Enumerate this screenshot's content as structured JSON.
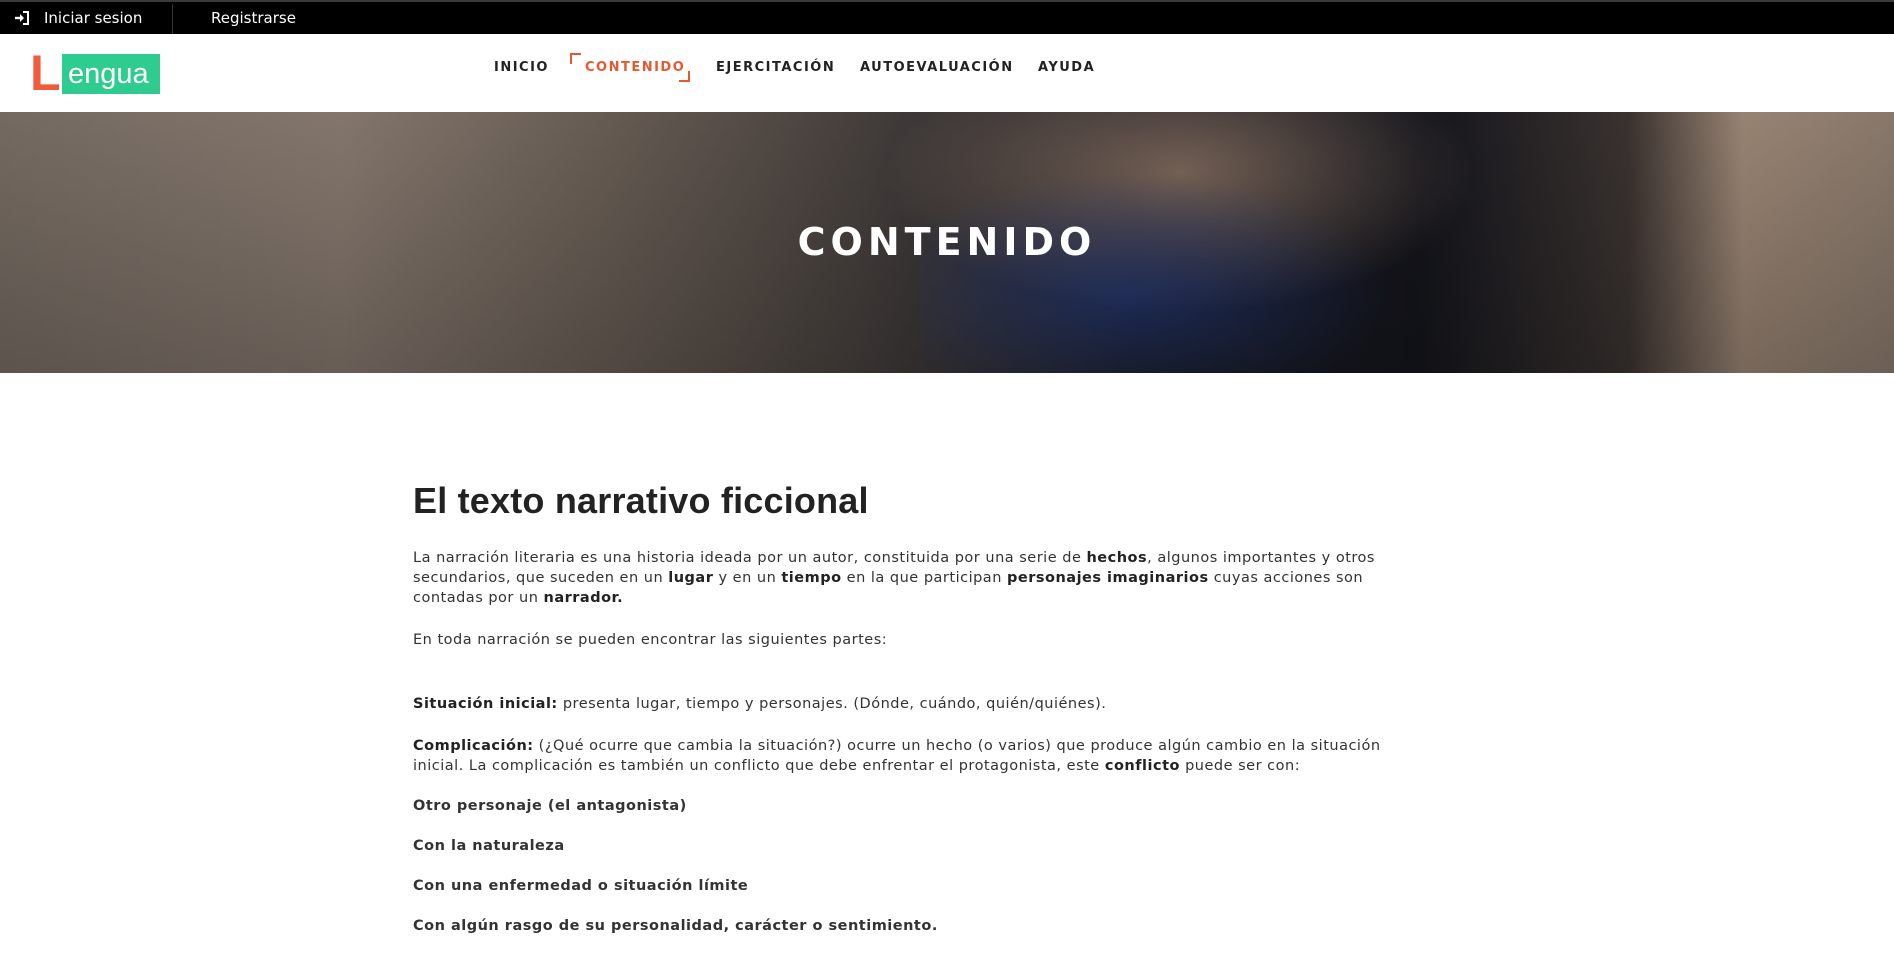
{
  "topbar": {
    "login_label": "Iniciar sesion",
    "register_label": "Registrarse",
    "login_icon": "sign-in-icon"
  },
  "logo": {
    "letter": "L",
    "text": "engua",
    "colors": {
      "letter": "#f15a3a",
      "box": "#2ecc8f"
    }
  },
  "nav": {
    "items": [
      {
        "label": "INICIO"
      },
      {
        "label": "CONTENIDO",
        "active": true
      },
      {
        "label": "EJERCITACIÓN"
      },
      {
        "label": "AUTOEVALUACIÓN"
      },
      {
        "label": "AYUDA"
      }
    ],
    "accent": "#e8582f"
  },
  "hero": {
    "title": "CONTENIDO"
  },
  "article": {
    "title": "El texto narrativo ficcional",
    "intro": {
      "t1": " La narración literaria es una historia ideada por un autor, constituida por una serie de ",
      "b1": "hechos",
      "t2": ", algunos importantes  y otros secundarios, que suceden en un ",
      "b2": "lugar",
      "t3": " y en un ",
      "b3": "tiempo",
      "t4": " en la que participan ",
      "b4": "personajes imaginarios",
      "t5": " cuyas acciones son contadas por un ",
      "b5": "narrador."
    },
    "parts_intro": "En toda narración se pueden encontrar las siguientes partes:",
    "situacion": {
      "label": "Situación inicial:",
      "text": " presenta lugar, tiempo y personajes. (Dónde, cuándo, quién/quiénes)."
    },
    "complicacion": {
      "label": "Complicación:",
      "text": " (¿Qué ocurre que cambia la situación?) ocurre un hecho (o varios) que produce algún cambio en la situación inicial. La complicación es también un conflicto que debe enfrentar el protagonista, este ",
      "bold": "conflicto",
      "text2": " puede ser con:"
    },
    "conflicts": [
      "Otro personaje (el antagonista)",
      "Con la naturaleza",
      "Con una enfermedad o situación límite",
      "Con algún rasgo de su personalidad, carácter o sentimiento."
    ]
  }
}
